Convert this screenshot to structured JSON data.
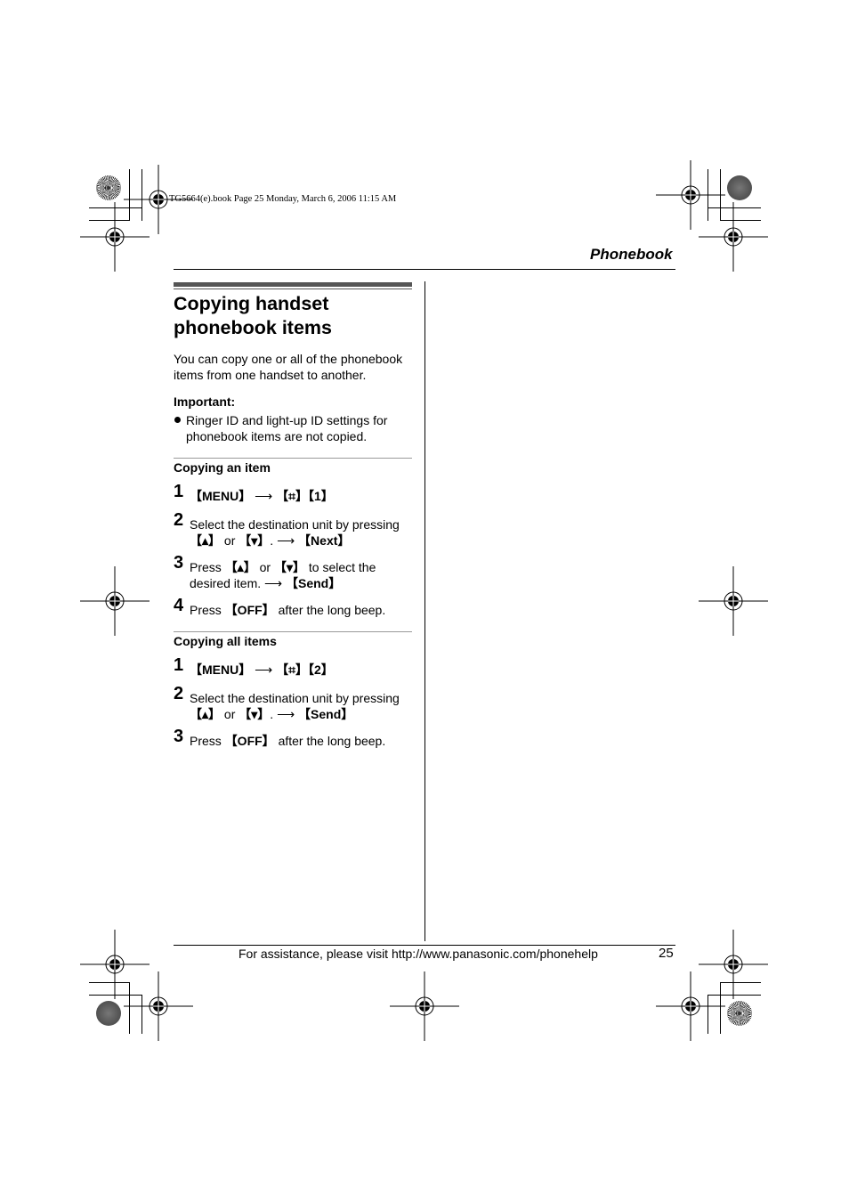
{
  "print_info": "TG5664(e).book  Page 25  Monday, March 6, 2006  11:15 AM",
  "section_header": "Phonebook",
  "title_line1": "Copying handset",
  "title_line2": "phonebook items",
  "intro": "You can copy one or all of the phonebook items from one handset to another.",
  "important_label": "Important:",
  "important_bullets": [
    "Ringer ID and light-up ID settings for phonebook items are not copied."
  ],
  "sections": [
    {
      "heading": "Copying an item",
      "steps": [
        {
          "num": "1",
          "html": "<span class='key'>[MENU]</span> &#x27F6; <span class='key'>[&#x2317;][1]</span>"
        },
        {
          "num": "2",
          "html": "Select the destination unit by pressing <span class='key'>[&#x25B4;]</span> or <span class='key'>[&#x25BE;]</span>. &#x27F6; <span class='key'>[Next]</span>"
        },
        {
          "num": "3",
          "html": "Press <span class='key'>[&#x25B4;]</span> or <span class='key'>[&#x25BE;]</span> to select the desired item. &#x27F6; <span class='key'>[Send]</span>"
        },
        {
          "num": "4",
          "html": "Press <span class='key'>[OFF]</span> after the long beep."
        }
      ]
    },
    {
      "heading": "Copying all items",
      "steps": [
        {
          "num": "1",
          "html": "<span class='key'>[MENU]</span> &#x27F6; <span class='key'>[&#x2317;][2]</span>"
        },
        {
          "num": "2",
          "html": "Select the destination unit by pressing <span class='key'>[&#x25B4;]</span> or <span class='key'>[&#x25BE;]</span>. &#x27F6; <span class='key'>[Send]</span>"
        },
        {
          "num": "3",
          "html": "Press <span class='key'>[OFF]</span> after the long beep."
        }
      ]
    }
  ],
  "footer_text": "For assistance, please visit http://www.panasonic.com/phonehelp",
  "page_number": "25"
}
